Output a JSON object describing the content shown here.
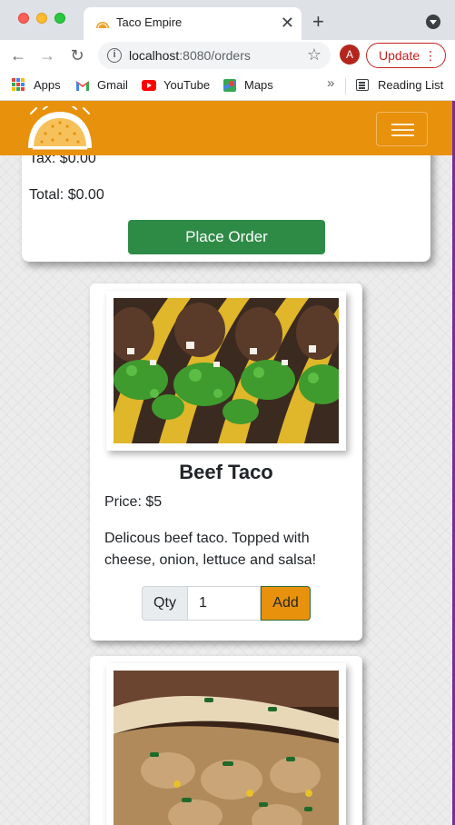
{
  "browser": {
    "tab_title": "Taco Empire",
    "url_host": "localhost",
    "url_path": ":8080/orders",
    "profile_initial": "A",
    "update_label": "Update",
    "bookmarks": [
      {
        "label": "Apps",
        "icon": "apps-grid-icon"
      },
      {
        "label": "Gmail",
        "icon": "gmail-icon"
      },
      {
        "label": "YouTube",
        "icon": "youtube-icon"
      },
      {
        "label": "Maps",
        "icon": "maps-icon"
      }
    ],
    "overflow_label": "»",
    "reading_list_label": "Reading List"
  },
  "app": {
    "brand_color": "#e8910c",
    "logo_icon": "taco-logo-icon",
    "menu_icon": "hamburger-menu-icon"
  },
  "order_summary": {
    "tax_label": "Tax: $0.00",
    "total_label": "Total: $0.00",
    "place_order_label": "Place Order"
  },
  "menu_items": [
    {
      "name": "Beef Taco",
      "price": "Price: $5",
      "description": "Delicous beef taco. Topped with cheese, onion, lettuce and salsa!",
      "qty_label": "Qty",
      "qty_value": "1",
      "add_label": "Add"
    }
  ]
}
